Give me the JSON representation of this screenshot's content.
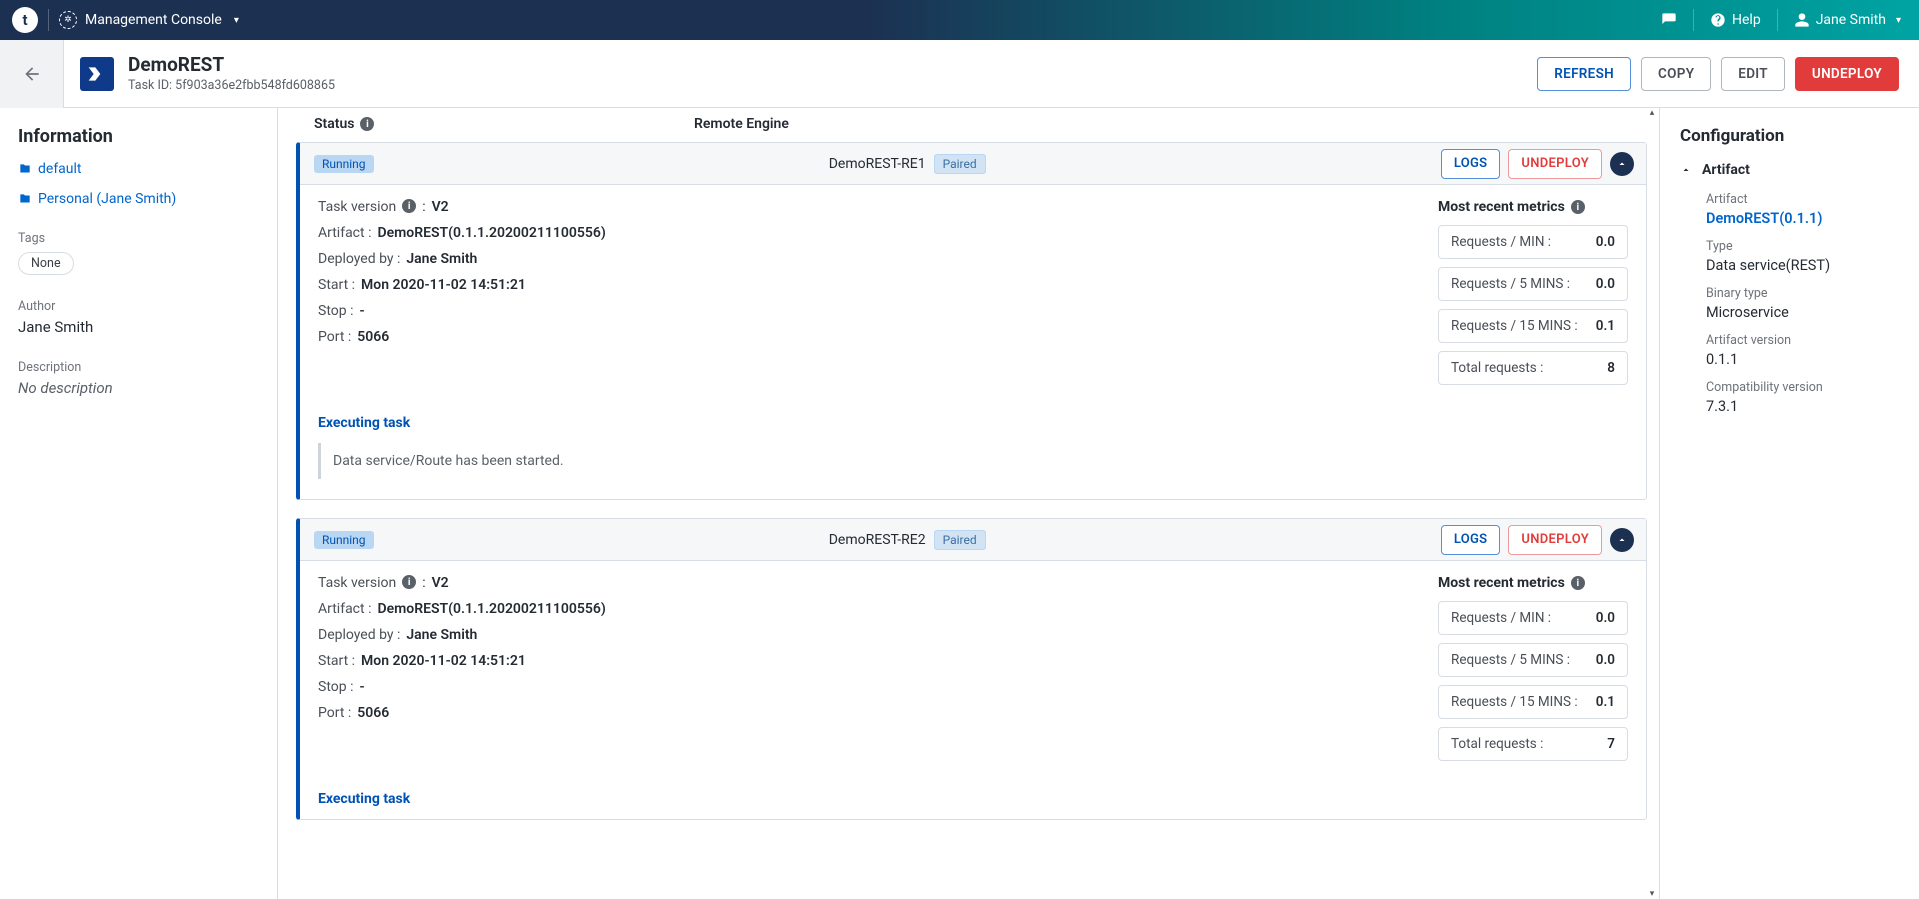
{
  "topbar": {
    "console_label": "Management Console",
    "help_label": "Help",
    "user_name": "Jane Smith"
  },
  "header": {
    "task_name": "DemoREST",
    "task_id_label": "Task ID: 5f903a36e2fbb548fd608865",
    "actions": {
      "refresh": "REFRESH",
      "copy": "COPY",
      "edit": "EDIT",
      "undeploy": "UNDEPLOY"
    }
  },
  "left": {
    "title": "Information",
    "env_default": "default",
    "env_personal": "Personal (Jane Smith)",
    "tags_label": "Tags",
    "tags_value": "None",
    "author_label": "Author",
    "author_value": "Jane Smith",
    "desc_label": "Description",
    "desc_value": "No description"
  },
  "columns": {
    "status": "Status",
    "remote": "Remote Engine"
  },
  "engines": [
    {
      "status": "Running",
      "name": "DemoREST-RE1",
      "paired": "Paired",
      "logs": "LOGS",
      "undeploy": "UNDEPLOY",
      "task_version_label": "Task version",
      "task_version": "V2",
      "artifact_label": "Artifact :",
      "artifact": "DemoREST(0.1.1.20200211100556)",
      "deployed_by_label": "Deployed by :",
      "deployed_by": "Jane Smith",
      "start_label": "Start :",
      "start": "Mon 2020-11-02 14:51:21",
      "stop_label": "Stop :",
      "stop": "-",
      "port_label": "Port :",
      "port": "5066",
      "metrics_title": "Most recent metrics",
      "metrics": [
        {
          "label": "Requests / MIN :",
          "value": "0.0"
        },
        {
          "label": "Requests / 5 MINS :",
          "value": "0.0"
        },
        {
          "label": "Requests / 15 MINS :",
          "value": "0.1"
        },
        {
          "label": "Total requests :",
          "value": "8"
        }
      ],
      "executing_title": "Executing task",
      "executing_msg": "Data service/Route has been started."
    },
    {
      "status": "Running",
      "name": "DemoREST-RE2",
      "paired": "Paired",
      "logs": "LOGS",
      "undeploy": "UNDEPLOY",
      "task_version_label": "Task version",
      "task_version": "V2",
      "artifact_label": "Artifact :",
      "artifact": "DemoREST(0.1.1.20200211100556)",
      "deployed_by_label": "Deployed by :",
      "deployed_by": "Jane Smith",
      "start_label": "Start :",
      "start": "Mon 2020-11-02 14:51:21",
      "stop_label": "Stop :",
      "stop": "-",
      "port_label": "Port :",
      "port": "5066",
      "metrics_title": "Most recent metrics",
      "metrics": [
        {
          "label": "Requests / MIN :",
          "value": "0.0"
        },
        {
          "label": "Requests / 5 MINS :",
          "value": "0.0"
        },
        {
          "label": "Requests / 15 MINS :",
          "value": "0.1"
        },
        {
          "label": "Total requests :",
          "value": "7"
        }
      ],
      "executing_title": "Executing task",
      "executing_msg": ""
    }
  ],
  "config": {
    "title": "Configuration",
    "artifact_section": "Artifact",
    "artifact_label": "Artifact",
    "artifact_link": "DemoREST(0.1.1)",
    "type_label": "Type",
    "type_value": "Data service(REST)",
    "binary_label": "Binary type",
    "binary_value": "Microservice",
    "version_label": "Artifact version",
    "version_value": "0.1.1",
    "compat_label": "Compatibility version",
    "compat_value": "7.3.1"
  }
}
